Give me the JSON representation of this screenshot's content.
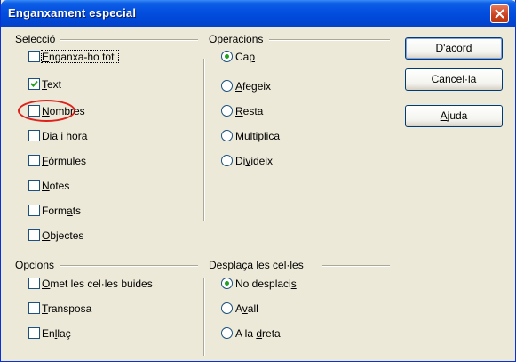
{
  "window": {
    "title": "Enganxament especial"
  },
  "seleccio": {
    "label": "Selecció",
    "items": [
      {
        "label": "Enganxa-ho tot",
        "mn": "E",
        "rest": "nganxa-ho tot",
        "pre": "",
        "checked": false
      },
      {
        "label": "Text",
        "mn": "T",
        "rest": "ext",
        "pre": "",
        "checked": true
      },
      {
        "label": "Nombres",
        "mn": "N",
        "rest": "ombres",
        "pre": "",
        "checked": false
      },
      {
        "label": "Dia i hora",
        "mn": "D",
        "rest": "ia i hora",
        "pre": "",
        "checked": false
      },
      {
        "label": "Fórmules",
        "mn": "F",
        "rest": "órmules",
        "pre": "",
        "checked": false
      },
      {
        "label": "Notes",
        "mn": "N",
        "rest": "otes",
        "pre": "",
        "checked": false
      },
      {
        "label": "Formats",
        "pre": "Form",
        "mn": "a",
        "rest": "ts",
        "checked": false
      },
      {
        "label": "Objectes",
        "pre": "",
        "mn": "O",
        "rest": "bjectes",
        "checked": false
      }
    ]
  },
  "operacions": {
    "label": "Operacions",
    "items": [
      {
        "label": "Cap",
        "pre": "Ca",
        "mn": "p",
        "rest": "",
        "selected": true
      },
      {
        "label": "Afegeix",
        "pre": "",
        "mn": "A",
        "rest": "fegeix",
        "selected": false
      },
      {
        "label": "Resta",
        "pre": "",
        "mn": "R",
        "rest": "esta",
        "selected": false
      },
      {
        "label": "Multiplica",
        "pre": "",
        "mn": "M",
        "rest": "ultiplica",
        "selected": false
      },
      {
        "label": "Divideix",
        "pre": "Di",
        "mn": "v",
        "rest": "ideix",
        "selected": false
      }
    ]
  },
  "opcions": {
    "label": "Opcions",
    "items": [
      {
        "label": "Omet les cel·les buides",
        "pre": "",
        "mn": "O",
        "rest": "met les cel·les buides",
        "checked": false
      },
      {
        "label": "Transposa",
        "pre": "",
        "mn": "T",
        "rest": "ransposa",
        "checked": false
      },
      {
        "label": "Enllaç",
        "pre": "En",
        "mn": "l",
        "rest": "laç",
        "checked": false
      }
    ]
  },
  "desplaca": {
    "label": "Desplaça les cel·les",
    "items": [
      {
        "label": "No desplacis",
        "pre": "No desplaci",
        "mn": "s",
        "rest": "",
        "selected": true
      },
      {
        "label": "Avall",
        "pre": "A",
        "mn": "v",
        "rest": "all",
        "selected": false
      },
      {
        "label": "A la dreta",
        "pre": "A la ",
        "mn": "d",
        "rest": "reta",
        "selected": false
      }
    ]
  },
  "buttons": {
    "ok": "D'acord",
    "cancel": "Cancel·la",
    "help": {
      "pre": "",
      "mn": "A",
      "rest": "juda"
    }
  },
  "colors": {
    "annotation": "#e0201a",
    "radio_dot": "#21a121",
    "title_bar": "#0451e0"
  }
}
